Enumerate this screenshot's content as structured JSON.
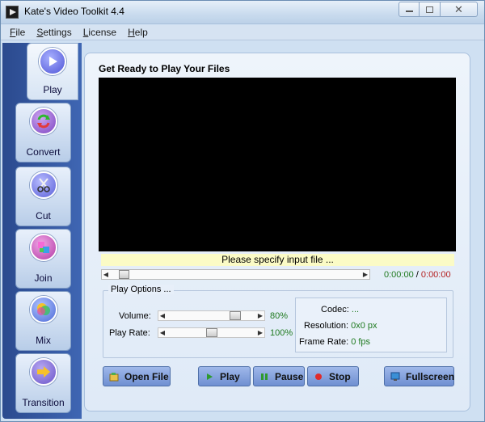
{
  "window": {
    "title": "Kate's Video Toolkit 4.4"
  },
  "menu": [
    {
      "accel": "F",
      "rest": "ile"
    },
    {
      "accel": "S",
      "rest": "ettings"
    },
    {
      "accel": "L",
      "rest": "icense"
    },
    {
      "accel": "H",
      "rest": "elp"
    }
  ],
  "sidebar": {
    "items": [
      {
        "label": "Play",
        "icon": "play-icon",
        "color": "#6a6ee0"
      },
      {
        "label": "Convert",
        "icon": "convert-icon",
        "color": "#8a55c8"
      },
      {
        "label": "Cut",
        "icon": "scissors-icon",
        "color": "#7f7fe0"
      },
      {
        "label": "Join",
        "icon": "join-icon",
        "color": "#c64ab0"
      },
      {
        "label": "Mix",
        "icon": "mix-icon",
        "color": "#5a7ae0"
      },
      {
        "label": "Transition",
        "icon": "arrow-right-icon",
        "color": "#7a6ad0"
      }
    ],
    "active": "Play"
  },
  "panel": {
    "title": "Get Ready to Play Your Files",
    "status": "Please specify input file ...",
    "time_current": "0:00:00",
    "time_separator": "/",
    "time_total": "0:00:00",
    "seek_fraction": 0.0
  },
  "options": {
    "label": "Play Options ...",
    "volume_label": "Volume:",
    "volume_value": "80%",
    "volume_fraction": 0.8,
    "rate_label": "Play Rate:",
    "rate_value": "100%",
    "rate_fraction": 0.5,
    "codec_label": "Codec:",
    "codec_value": "...",
    "resolution_label": "Resolution:",
    "resolution_value": "0x0 px",
    "framerate_label": "Frame Rate:",
    "framerate_value": "0 fps"
  },
  "buttons": {
    "open": "Open File",
    "play": "Play",
    "pause": "Pause",
    "stop": "Stop",
    "fullscreen": "Fullscreen"
  },
  "colors": {
    "accent_green": "#1f7a1f",
    "accent_red": "#b42020",
    "button_blue": "#6f8fd1",
    "sidebar_blue": "#2b4a8e"
  }
}
